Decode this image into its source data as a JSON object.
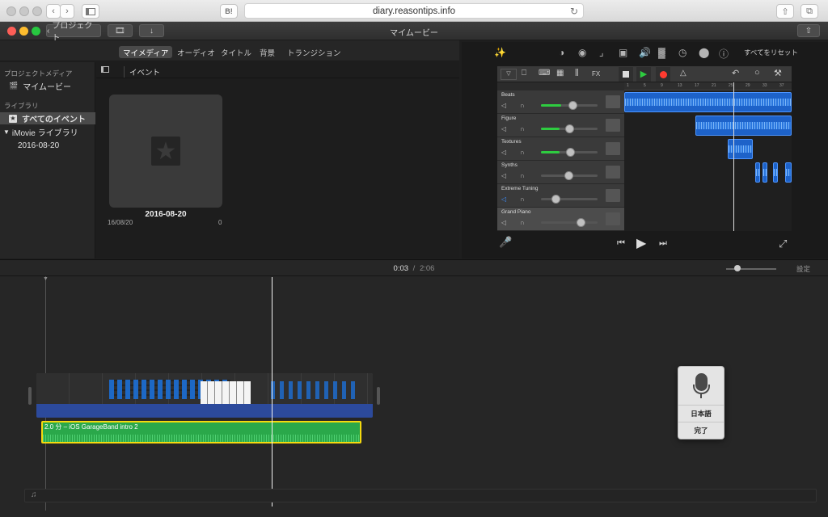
{
  "safari": {
    "url": "diary.reasontips.info",
    "bookmark_label": "B!"
  },
  "imovie": {
    "back_button": "プロジェクト",
    "window_title": "マイムービー",
    "media_tabs": [
      "マイメディア",
      "オーディオ",
      "タイトル",
      "背景",
      "トランジション"
    ],
    "active_tab": "マイメディア",
    "sidebar": {
      "project_media_header": "プロジェクトメディア",
      "project_item": "マイムービー",
      "library_header": "ライブラリ",
      "all_events": "すべてのイベント",
      "library_name": "iMovie ライブラリ",
      "event_date": "2016-08-20"
    },
    "browser": {
      "events_label": "イベント",
      "event_title": "2016-08-20",
      "event_short_date": "16/08/20",
      "event_count": "0"
    },
    "viewer": {
      "reset_all": "すべてをリセット"
    },
    "timeline": {
      "current_time": "0:03",
      "separator": "/",
      "total_time": "2:06",
      "settings_label": "設定",
      "audio_clip_label": "2.0 分 – iOS GarageBand intro 2"
    }
  },
  "garageband": {
    "fx_label": "FX",
    "tracks": [
      {
        "name": "Beats",
        "level": 0.55
      },
      {
        "name": "Figure",
        "level": 0.5
      },
      {
        "name": "Textures",
        "level": 0.52
      },
      {
        "name": "Synths",
        "level": 0.48
      },
      {
        "name": "Extreme Tuning",
        "level": 0.25
      },
      {
        "name": "Grand Piano",
        "level": 0.7
      }
    ],
    "ruler": [
      "1",
      "5",
      "9",
      "13",
      "17",
      "21",
      "25",
      "29",
      "33",
      "37"
    ]
  },
  "dictation": {
    "language": "日本語",
    "done": "完了"
  },
  "colors": {
    "audio_clip": "#2aa84a",
    "selection": "#f5d90e",
    "region": "#1d62c9"
  }
}
